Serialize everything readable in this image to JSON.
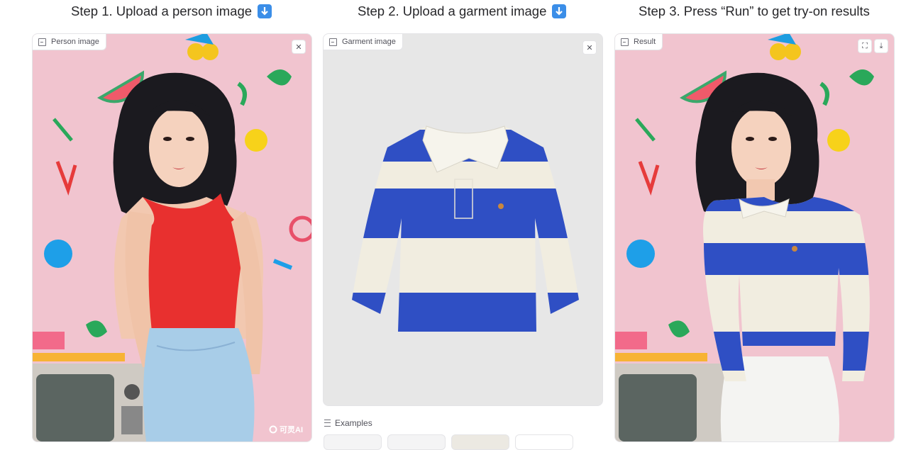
{
  "steps": {
    "step1": "Step 1. Upload a person image",
    "step2": "Step 2. Upload a garment image",
    "step3": "Step 3. Press “Run” to get try-on results",
    "download_emoji": "⬇️"
  },
  "person_panel": {
    "label": "Person image",
    "close_glyph": "✕",
    "watermark": "可灵AI"
  },
  "garment_panel": {
    "label": "Garment image",
    "close_glyph": "✕"
  },
  "result_panel": {
    "label": "Result",
    "fullscreen_glyph": "⛶",
    "download_glyph": "⤓"
  },
  "examples": {
    "label": "Examples"
  },
  "colors": {
    "wall_pink": "#f1c4cf",
    "red_top": "#e8302f",
    "jeans": "#a8cde8",
    "stripe_blue": "#2f4fc4",
    "stripe_cream": "#f1ede0",
    "hair": "#1b1a1f"
  }
}
